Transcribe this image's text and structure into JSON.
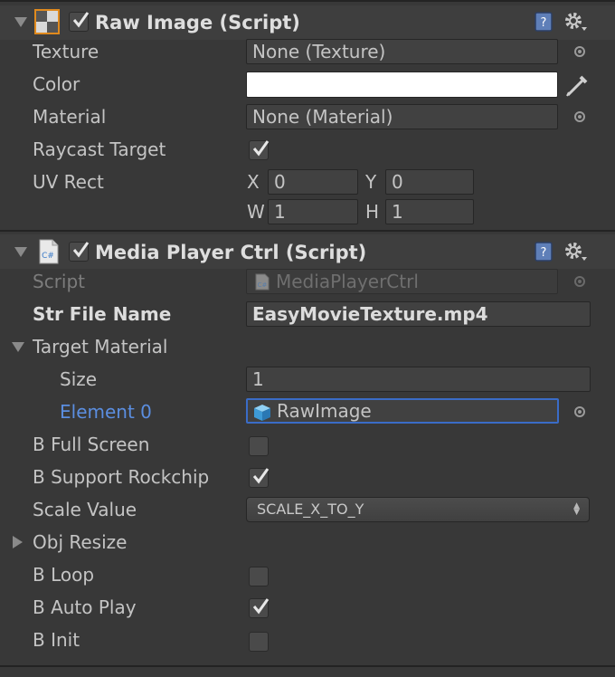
{
  "raw_image": {
    "title": "Raw Image (Script)",
    "enabled": true,
    "fields": {
      "texture": {
        "label": "Texture",
        "value": "None (Texture)"
      },
      "color": {
        "label": "Color",
        "value": "#ffffff"
      },
      "material": {
        "label": "Material",
        "value": "None (Material)"
      },
      "raycast_target": {
        "label": "Raycast Target",
        "checked": true
      },
      "uv_rect": {
        "label": "UV Rect",
        "x_label": "X",
        "x": "0",
        "y_label": "Y",
        "y": "0",
        "w_label": "W",
        "w": "1",
        "h_label": "H",
        "h": "1"
      }
    }
  },
  "media_player": {
    "title": "Media Player Ctrl (Script)",
    "enabled": true,
    "fields": {
      "script": {
        "label": "Script",
        "value": "MediaPlayerCtrl"
      },
      "str_file_name": {
        "label": "Str File Name",
        "value": "EasyMovieTexture.mp4"
      },
      "target_material": {
        "label": "Target Material",
        "expanded": true
      },
      "size": {
        "label": "Size",
        "value": "1"
      },
      "element0": {
        "label": "Element 0",
        "value": "RawImage"
      },
      "b_full_screen": {
        "label": "B Full Screen",
        "checked": false
      },
      "b_support_rockchip": {
        "label": "B Support Rockchip",
        "checked": true
      },
      "scale_value": {
        "label": "Scale Value",
        "value": "SCALE_X_TO_Y"
      },
      "obj_resize": {
        "label": "Obj Resize",
        "expanded": false
      },
      "b_loop": {
        "label": "B Loop",
        "checked": false
      },
      "b_auto_play": {
        "label": "B Auto Play",
        "checked": true
      },
      "b_init": {
        "label": "B Init",
        "checked": false
      }
    }
  },
  "icons": {
    "foldout": "triangle-down-icon",
    "help": "book-help-icon",
    "settings": "gear-icon",
    "object_picker": "target-circle-icon",
    "eyedropper": "eyedropper-icon"
  },
  "colors": {
    "background": "#383838",
    "selection": "#3a6cc7",
    "highlight_label": "#5b8ee0"
  }
}
